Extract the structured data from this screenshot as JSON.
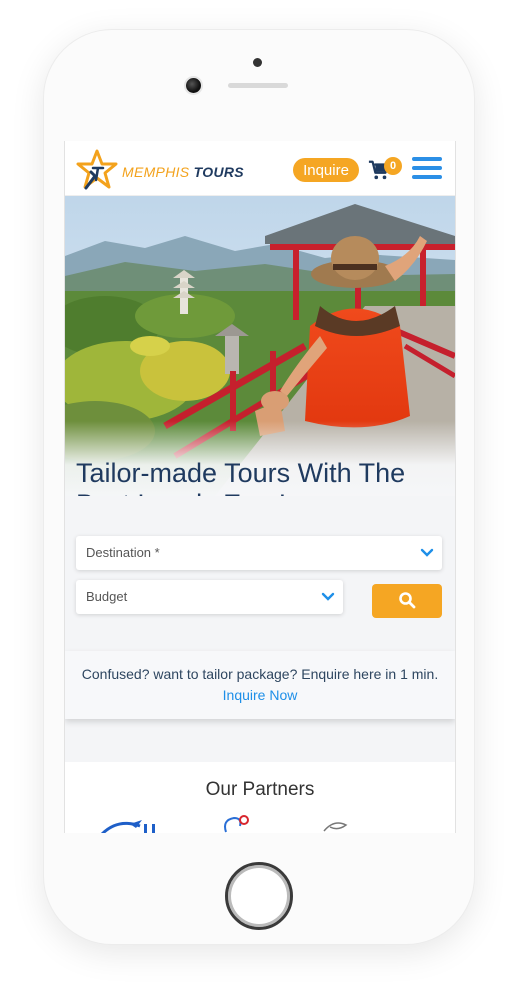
{
  "brand": {
    "name_part1": "MEMPHIS",
    "name_part2": "TOURS"
  },
  "header": {
    "inquire_label": "Inquire",
    "cart_count": "0"
  },
  "hero": {
    "title": "Tailor-made Tours With The Best Locals Ever!"
  },
  "form": {
    "destination_placeholder": "Destination *",
    "budget_placeholder": "Budget"
  },
  "inquiry": {
    "text": "Confused? want to tailor package? Enquire here in 1 min.",
    "link_label": "Inquire Now"
  },
  "partners": {
    "title": "Our Partners"
  },
  "colors": {
    "accent": "#f5a623",
    "brand_navy": "#1f3a5f",
    "link_blue": "#1e8fe8"
  },
  "icons": [
    "star-logo-icon",
    "cart-icon",
    "hamburger-menu-icon",
    "chevron-down-icon",
    "search-icon"
  ]
}
